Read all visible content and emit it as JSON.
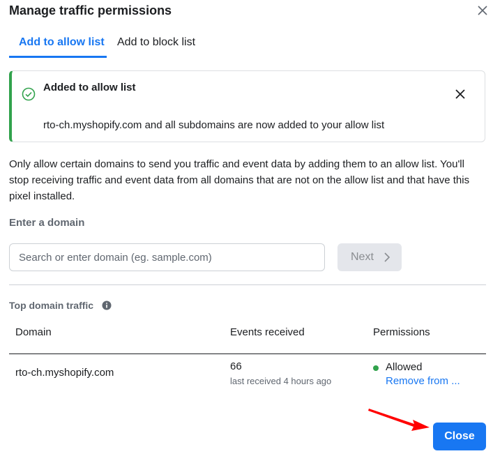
{
  "dialog": {
    "title": "Manage traffic permissions"
  },
  "tabs": [
    {
      "label": "Add to allow list",
      "active": true
    },
    {
      "label": "Add to block list",
      "active": false
    }
  ],
  "banner": {
    "title": "Added to allow list",
    "message": "rto-ch.myshopify.com and all subdomains are now added to your allow list",
    "status_color": "#31a24c"
  },
  "description": "Only allow certain domains to send you traffic and event data by adding them to an allow list. You'll stop receiving traffic and event data from all domains that are not on the allow list and that have this pixel installed.",
  "domain_entry": {
    "label": "Enter a domain",
    "placeholder": "Search or enter domain (eg. sample.com)",
    "value": "",
    "next_label": "Next"
  },
  "top_domains": {
    "label": "Top domain traffic",
    "columns": [
      "Domain",
      "Events received",
      "Permissions"
    ],
    "rows": [
      {
        "domain": "rto-ch.myshopify.com",
        "events": "66",
        "last_received": "last received 4 hours ago",
        "status": "Allowed",
        "action": "Remove from ..."
      }
    ]
  },
  "footer": {
    "close_label": "Close"
  },
  "colors": {
    "accent": "#1877f2",
    "success": "#31a24c",
    "annotation_arrow": "#ff0000"
  }
}
